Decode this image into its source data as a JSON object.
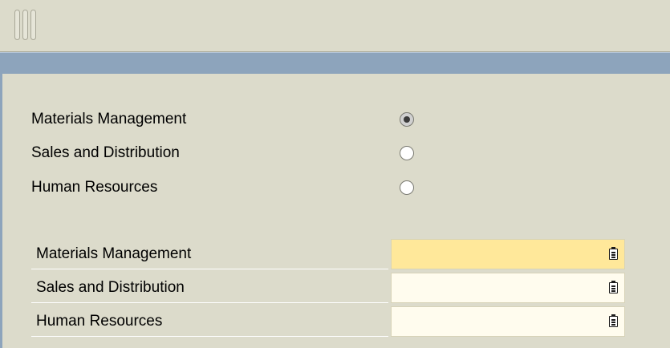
{
  "radio_group": {
    "options": [
      {
        "label": "Materials Management",
        "checked": true
      },
      {
        "label": "Sales and Distribution",
        "checked": false
      },
      {
        "label": "Human Resources",
        "checked": false
      }
    ]
  },
  "fields": [
    {
      "label": "Materials Management",
      "value": "",
      "focused": true,
      "icon": "value-help-icon"
    },
    {
      "label": "Sales and Distribution",
      "value": "",
      "focused": false,
      "icon": "value-help-icon"
    },
    {
      "label": "Human Resources",
      "value": "",
      "focused": false,
      "icon": "value-help-icon"
    }
  ],
  "colors": {
    "background": "#dcdbcb",
    "title_bar": "#8da4bc",
    "input_focused": "#ffe89a",
    "input_default": "#fffcee"
  }
}
